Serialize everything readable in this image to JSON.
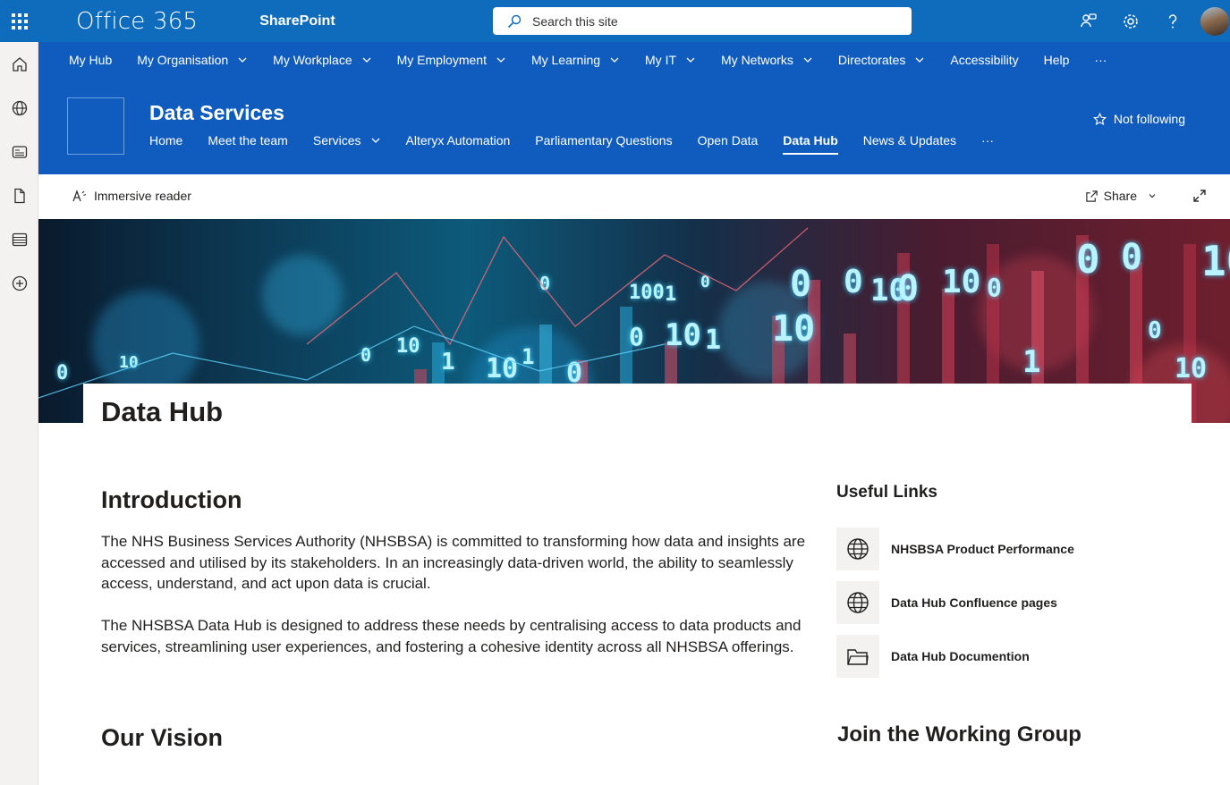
{
  "suite": {
    "brand": "Office 365",
    "app": "SharePoint",
    "search_placeholder": "Search this site"
  },
  "hub_nav": {
    "items": [
      {
        "label": "My Hub",
        "dropdown": false
      },
      {
        "label": "My Organisation",
        "dropdown": true
      },
      {
        "label": "My Workplace",
        "dropdown": true
      },
      {
        "label": "My Employment",
        "dropdown": true
      },
      {
        "label": "My Learning",
        "dropdown": true
      },
      {
        "label": "My IT",
        "dropdown": true
      },
      {
        "label": "My Networks",
        "dropdown": true
      },
      {
        "label": "Directorates",
        "dropdown": true
      },
      {
        "label": "Accessibility",
        "dropdown": false
      },
      {
        "label": "Help",
        "dropdown": false
      }
    ],
    "more": "···"
  },
  "site": {
    "title": "Data Services",
    "follow_label": "Not following",
    "nav": [
      {
        "label": "Home",
        "dropdown": false,
        "active": false
      },
      {
        "label": "Meet the team",
        "dropdown": false,
        "active": false
      },
      {
        "label": "Services",
        "dropdown": true,
        "active": false
      },
      {
        "label": "Alteryx Automation",
        "dropdown": false,
        "active": false
      },
      {
        "label": "Parliamentary Questions",
        "dropdown": false,
        "active": false
      },
      {
        "label": "Open Data",
        "dropdown": false,
        "active": false
      },
      {
        "label": "Data Hub",
        "dropdown": false,
        "active": true
      },
      {
        "label": "News & Updates",
        "dropdown": false,
        "active": false
      }
    ],
    "more": "···"
  },
  "command_bar": {
    "immersive_reader": "Immersive reader",
    "share": "Share"
  },
  "banner": {
    "digits": [
      "0",
      "10",
      "0",
      "10",
      "1",
      "10",
      "1",
      "0",
      "100",
      "1",
      "0",
      "0",
      "10",
      "1",
      "10",
      "0",
      "0",
      "10",
      "0",
      "10",
      "0",
      "1",
      "0",
      "0",
      "10",
      "10",
      "0",
      "0"
    ]
  },
  "page": {
    "title": "Data Hub",
    "intro_heading": "Introduction",
    "intro_p1": "The NHS Business Services Authority (NHSBSA) is committed to transforming how data and insights are accessed and utilised by its stakeholders. In an increasingly data-driven world, the ability to seamlessly access, understand, and act upon data is crucial.",
    "intro_p2": "The NHSBSA Data Hub is designed to address these needs by centralising access to data products and services, streamlining user experiences, and fostering a cohesive identity across all NHSBSA offerings.",
    "vision_heading": "Our Vision"
  },
  "sidebar": {
    "useful_links_heading": "Useful Links",
    "links": [
      {
        "label": "NHSBSA Product Performance",
        "icon": "globe-icon"
      },
      {
        "label": "Data Hub Confluence pages",
        "icon": "globe-icon"
      },
      {
        "label": "Data Hub Documention",
        "icon": "folder-icon"
      }
    ],
    "join_heading": "Join the Working Group"
  },
  "colors": {
    "suite_blue": "#0f6cbd",
    "site_blue": "#0f5cbe"
  }
}
